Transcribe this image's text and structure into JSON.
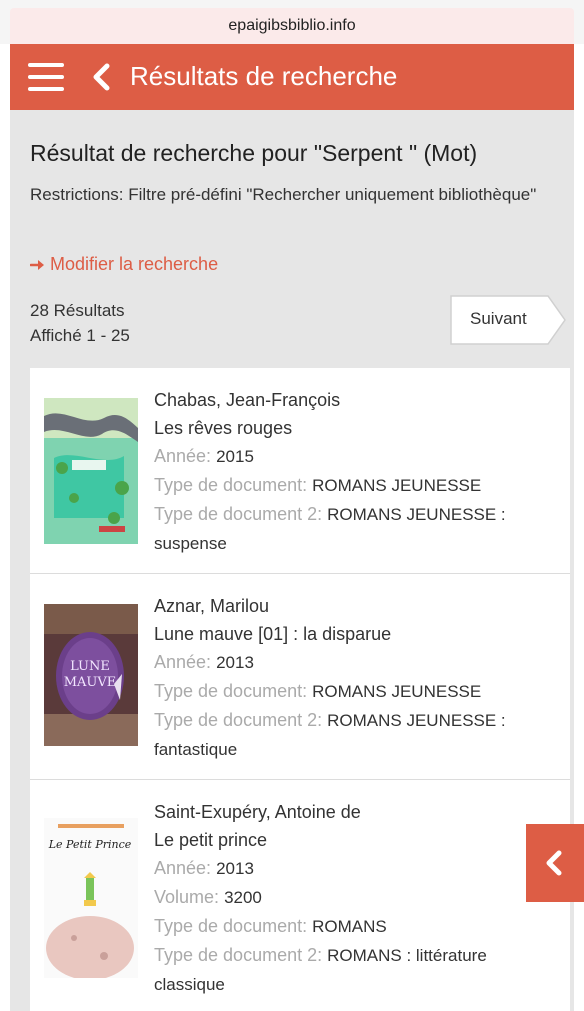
{
  "browser": {
    "url": "epaigibsbiblio.info"
  },
  "navbar": {
    "title": "Résultats de recherche",
    "menu_icon": "hamburger-menu-icon",
    "back_icon": "chevron-left-icon"
  },
  "search": {
    "heading": "Résultat de recherche pour \"Serpent \" (Mot)",
    "restrictions": "Restrictions: Filtre pré-défini \"Rechercher uniquement bibliothèque\"",
    "modify_label": "Modifier la recherche",
    "results_count": "28 Résultats",
    "displayed": "Affiché 1 - 25",
    "next_label": "Suivant"
  },
  "labels": {
    "year": "Année:",
    "volume": "Volume:",
    "doc_type": "Type de document:",
    "doc_type2": "Type de document 2:"
  },
  "results": [
    {
      "author": "Chabas, Jean-François",
      "title": "Les rêves rouges",
      "year": "2015",
      "doc_type": "ROMANS JEUNESSE",
      "doc_type2_line1": "ROMANS JEUNESSE :",
      "doc_type2_line2": "suspense"
    },
    {
      "author": "Aznar, Marilou",
      "title": "Lune mauve [01] : la disparue",
      "year": "2013",
      "cover_text_1": "LUNE",
      "cover_text_2": "MAUVE",
      "doc_type": "ROMANS JEUNESSE",
      "doc_type2_line1": "ROMANS JEUNESSE :",
      "doc_type2_line2": "fantastique"
    },
    {
      "author": "Saint-Exupéry, Antoine de",
      "title": "Le petit prince",
      "year": "2013",
      "volume": "3200",
      "cover_text": "Le Petit Prince",
      "doc_type": "ROMANS",
      "doc_type2_line1": "ROMANS : littérature",
      "doc_type2_line2": "classique"
    }
  ],
  "colors": {
    "accent": "#dd5d45",
    "background": "#e6e6e6",
    "card": "#ffffff",
    "muted_label": "#aaaaaa"
  }
}
